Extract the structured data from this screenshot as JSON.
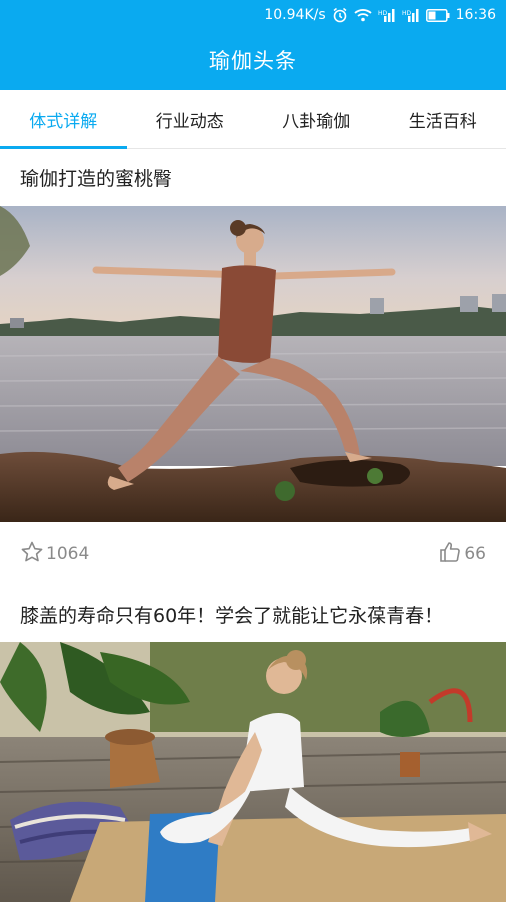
{
  "status_bar": {
    "network_speed": "10.94K/s",
    "time": "16:36",
    "icons": [
      "alarm-icon",
      "wifi-icon",
      "signal-icon",
      "signal-icon",
      "battery-icon"
    ]
  },
  "header": {
    "title": "瑜伽头条"
  },
  "tabs": [
    {
      "label": "体式详解",
      "active": true
    },
    {
      "label": "行业动态",
      "active": false
    },
    {
      "label": "八卦瑜伽",
      "active": false
    },
    {
      "label": "生活百科",
      "active": false
    }
  ],
  "articles": [
    {
      "title": "瑜伽打造的蜜桃臀",
      "image": "yoga-warrior-pose-photo",
      "favorites": "1064",
      "likes": "66"
    },
    {
      "title": "膝盖的寿命只有60年！学会了就能让它永葆青春！",
      "image": "yoga-split-pose-photo"
    }
  ],
  "colors": {
    "accent": "#0aaaf0",
    "text": "#222222",
    "meta": "#8a8a8a"
  }
}
